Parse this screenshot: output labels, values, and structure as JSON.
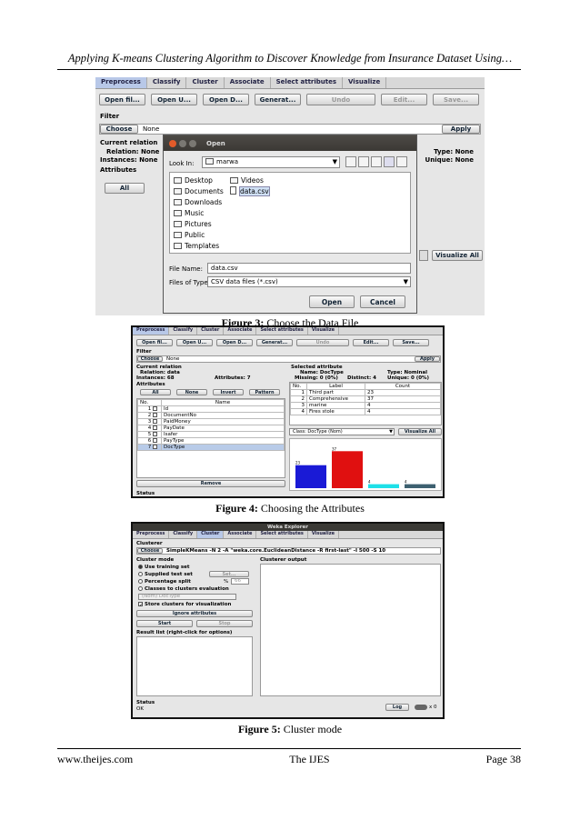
{
  "header": {
    "running_title": "Applying K-means Clustering Algorithm to Discover Knowledge from Insurance Dataset Using…"
  },
  "footer": {
    "website": "www.theijes.com",
    "journal": "The IJES",
    "page": "Page 38"
  },
  "captions": {
    "fig3": {
      "label": "Figure 3:",
      "text": "Choose the Data File"
    },
    "fig4": {
      "label": "Figure 4:",
      "text": "Choosing the Attributes"
    },
    "fig5": {
      "label": "Figure 5:",
      "text": "Cluster mode"
    }
  },
  "weka": {
    "tabs": [
      "Preprocess",
      "Classify",
      "Cluster",
      "Associate",
      "Select attributes",
      "Visualize"
    ],
    "toolbar": [
      "Open fil...",
      "Open U...",
      "Open D...",
      "Generat...",
      "Undo",
      "Edit...",
      "Save..."
    ],
    "filter_label": "Filter",
    "choose": "Choose",
    "filter_none": "None",
    "apply": "Apply",
    "current_relation": "Current relation",
    "attributes_label": "Attributes",
    "all": "All",
    "none": "None",
    "visualize_all": "Visualize All"
  },
  "fig3": {
    "relation_line1": "Relation: None",
    "relation_line2": "Instances: None",
    "type_line": "Type: None",
    "unique_line": "Unique: None",
    "dialog": {
      "title": "Open",
      "look_in_label": "Look In:",
      "look_in_value": "marwa",
      "col1": [
        "Desktop",
        "Documents",
        "Downloads",
        "Music",
        "Pictures",
        "Public",
        "Templates"
      ],
      "col2": [
        "Videos",
        "data.csv"
      ],
      "file_name_label": "File Name:",
      "file_name_value": "data.csv",
      "files_type_label": "Files of Type:",
      "files_type_value": "CSV data files (*.csv)",
      "open": "Open",
      "cancel": "Cancel"
    }
  },
  "fig4": {
    "toolbar": [
      "Open fil...",
      "Open U...",
      "Open D...",
      "Generat...",
      "Undo",
      "Edit...",
      "Save..."
    ],
    "relation": "Relation: data",
    "instances": "Instances: 68",
    "attributes_count": "Attributes: 7",
    "selected_attribute": "Selected attribute",
    "sel_name": "Name: DocType",
    "sel_missing": "Missing: 0 (0%)",
    "sel_distinct": "Distinct: 4",
    "sel_type": "Type: Nominal",
    "sel_unique": "Unique: 0 (0%)",
    "attr_buttons": [
      "All",
      "None",
      "Invert",
      "Pattern"
    ],
    "attr_headers": [
      "No.",
      "Name"
    ],
    "attr_rows": [
      {
        "no": "1",
        "name": "Id"
      },
      {
        "no": "2",
        "name": "DocumentNo"
      },
      {
        "no": "3",
        "name": "PaidMoney"
      },
      {
        "no": "4",
        "name": "PayDate"
      },
      {
        "no": "5",
        "name": "Isafer"
      },
      {
        "no": "6",
        "name": "PayType"
      },
      {
        "no": "7",
        "name": "DocType"
      }
    ],
    "remove": "Remove",
    "status": "Status",
    "label_headers": [
      "No.",
      "Label",
      "Count"
    ],
    "label_rows": [
      {
        "no": "1",
        "label": "Third part",
        "count": "23"
      },
      {
        "no": "2",
        "label": "Comprehensive",
        "count": "37"
      },
      {
        "no": "3",
        "label": "marine",
        "count": "4"
      },
      {
        "no": "4",
        "label": "Fires stole",
        "count": "4"
      }
    ],
    "class_select": "Class: DocType (Nom)",
    "visualize_all": "Visualize All",
    "colors": [
      "#1a1ad6",
      "#e01010",
      "#1ee0e8",
      "#3d6070"
    ]
  },
  "chart_data": {
    "type": "bar",
    "categories": [
      "Third part",
      "Comprehensive",
      "marine",
      "Fires stole"
    ],
    "values": [
      23,
      37,
      4,
      4
    ],
    "ylim": [
      0,
      40
    ],
    "grid": false,
    "title": "",
    "xlabel": "",
    "ylabel": ""
  },
  "fig5": {
    "title": "Weka Explorer",
    "clusterer_label": "Clusterer",
    "clusterer_value": "SimpleKMeans -N 2 -A \"weka.core.EuclideanDistance -R first-last\" -I 500 -S 10",
    "cluster_mode": "Cluster mode",
    "modes": [
      "Use training set",
      "Supplied test set",
      "Percentage split",
      "Classes to clusters evaluation"
    ],
    "set_button": "Set...",
    "percent_sign": "%",
    "percent_value": "66",
    "class_value": "(Nom) DocType",
    "store": "Store clusters for visualization",
    "ignore": "Ignore attributes",
    "start": "Start",
    "stop": "Stop",
    "result_list": "Result list (right-click for options)",
    "clusterer_output": "Clusterer output",
    "status": "Status",
    "status_value": "OK",
    "log": "Log",
    "x0": "x 0"
  }
}
